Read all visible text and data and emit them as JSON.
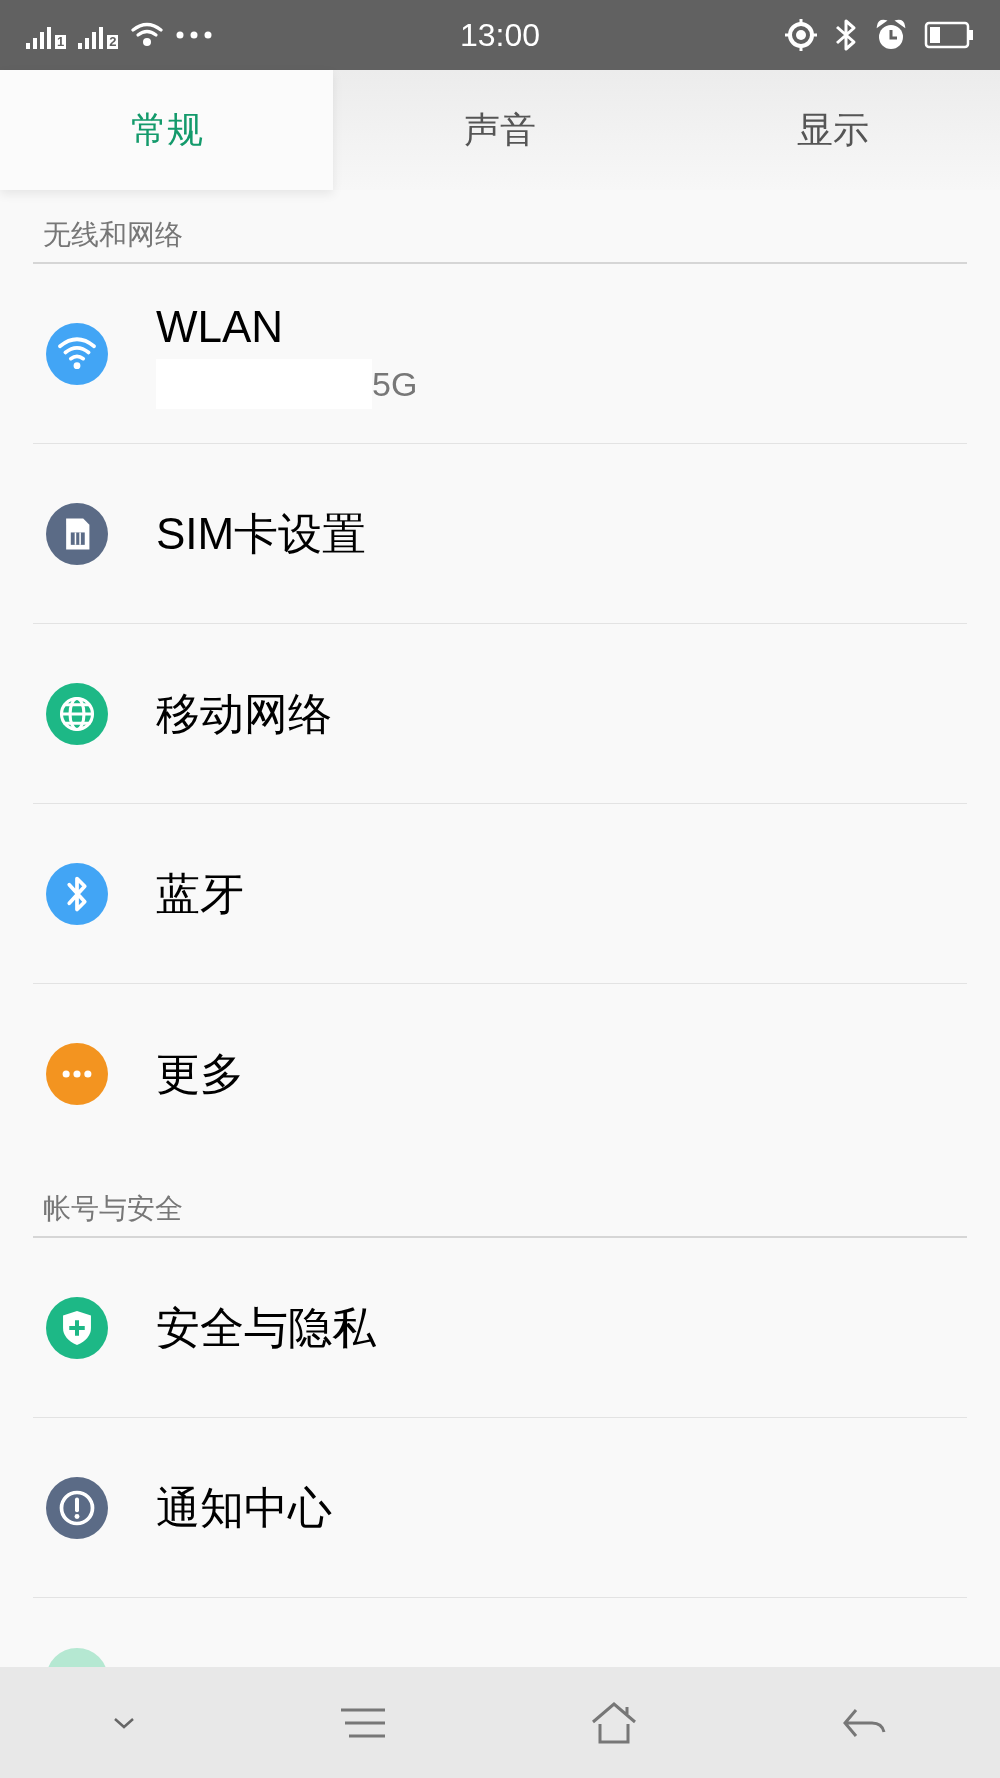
{
  "status_bar": {
    "sim_labels": [
      "1",
      "2"
    ],
    "time": "13:00"
  },
  "tabs": [
    {
      "label": "常规",
      "selected": true
    },
    {
      "label": "声音",
      "selected": false
    },
    {
      "label": "显示",
      "selected": false
    }
  ],
  "sections": [
    {
      "header": "无线和网络",
      "items": [
        {
          "kind": "wifi",
          "title": "WLAN",
          "subtitle": "5G"
        },
        {
          "kind": "sim",
          "title": "SIM卡设置"
        },
        {
          "kind": "globe",
          "title": "移动网络"
        },
        {
          "kind": "bluetooth",
          "title": "蓝牙"
        },
        {
          "kind": "more",
          "title": "更多"
        }
      ]
    },
    {
      "header": "帐号与安全",
      "items": [
        {
          "kind": "shield",
          "title": "安全与隐私"
        },
        {
          "kind": "alert",
          "title": "通知中心"
        }
      ]
    }
  ]
}
